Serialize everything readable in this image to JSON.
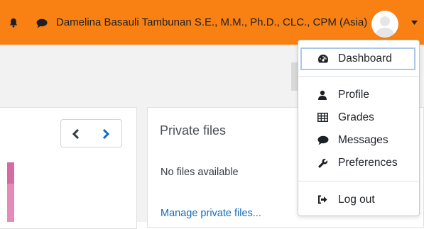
{
  "header": {
    "user_name": "Damelina Basauli Tambunan S.E., M.M., Ph.D., CLC., CPM (Asia)",
    "icons": [
      "bell-icon",
      "chat-icon",
      "avatar",
      "caret-down-icon"
    ],
    "bar_color": "#f98012"
  },
  "user_menu": {
    "items": [
      {
        "label": "Dashboard",
        "icon": "dashboard-icon"
      },
      {
        "label": "Profile",
        "icon": "user-icon"
      },
      {
        "label": "Grades",
        "icon": "table-icon"
      },
      {
        "label": "Messages",
        "icon": "comment-icon"
      },
      {
        "label": "Preferences",
        "icon": "wrench-icon"
      },
      {
        "label": "Log out",
        "icon": "sign-out-icon"
      }
    ]
  },
  "private_files": {
    "title": "Private files",
    "empty_text": "No files available",
    "manage_link": "Manage private files..."
  },
  "colors": {
    "link": "#0f6cbf",
    "accent_pink": "#e58bb8"
  }
}
